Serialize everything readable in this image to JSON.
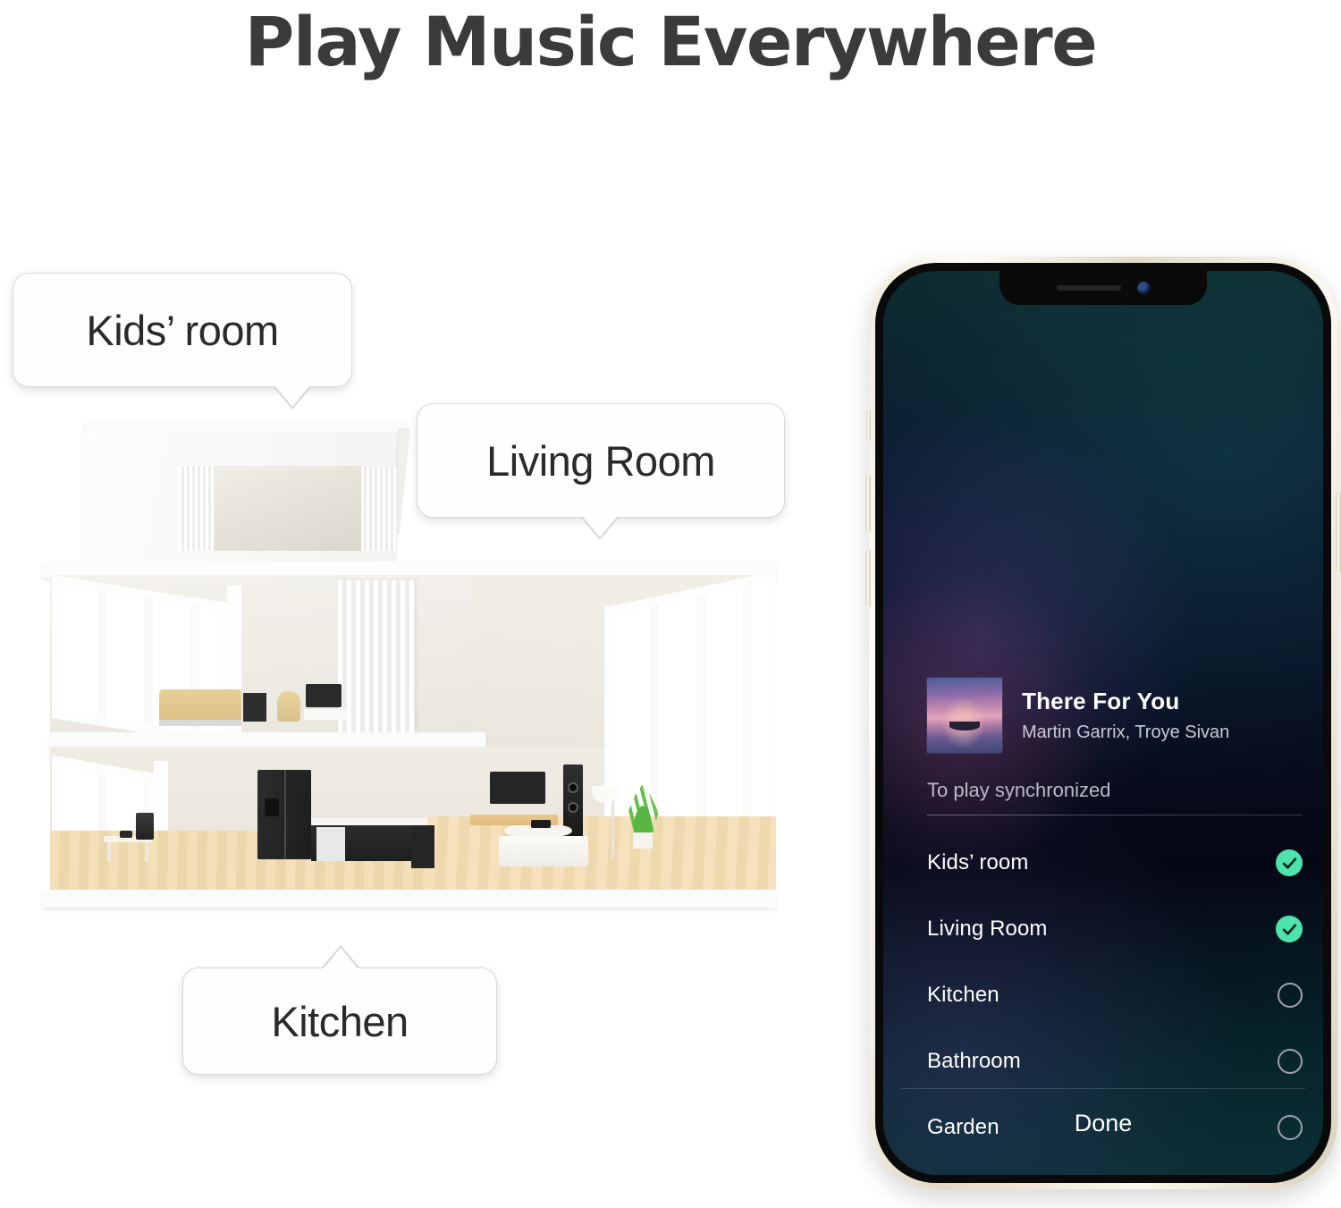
{
  "page": {
    "title": "Play Music Everywhere"
  },
  "illustration": {
    "name": "cutaway-house-3d-render",
    "bubbles": [
      {
        "id": "kids",
        "label": "Kids’ room",
        "tail": "down"
      },
      {
        "id": "living",
        "label": "Living Room",
        "tail": "down"
      },
      {
        "id": "kitchen",
        "label": "Kitchen",
        "tail": "up"
      }
    ]
  },
  "phone": {
    "now_playing": {
      "track_title": "There For You",
      "artists": "Martin Garrix, Troye Sivan",
      "album_art_alt": "sunset-boat-artwork"
    },
    "section_label": "To play synchronized",
    "rooms": [
      {
        "name": "Kids’ room",
        "selected": true
      },
      {
        "name": "Living Room",
        "selected": true
      },
      {
        "name": "Kitchen",
        "selected": false
      },
      {
        "name": "Bathroom",
        "selected": false
      },
      {
        "name": "Garden",
        "selected": false
      }
    ],
    "done_label": "Done"
  },
  "colors": {
    "title_text": "#3b3b3b",
    "accent_check": "#4ee3ad",
    "screen_text": "#ffffff",
    "secondary_text": "#b9bcc4",
    "phone_frame": "#efe9dc"
  }
}
